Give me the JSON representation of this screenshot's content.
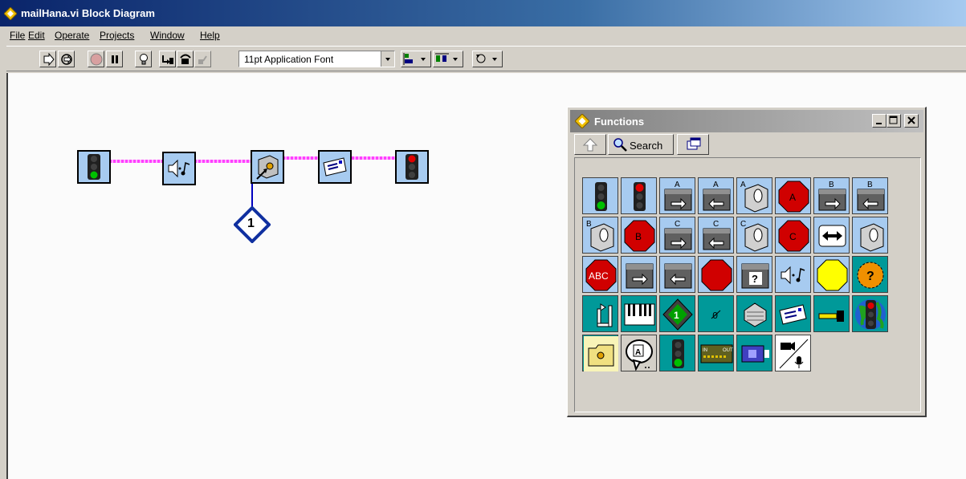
{
  "window": {
    "title": "mailHana.vi Block Diagram"
  },
  "menu": [
    "File",
    "Edit",
    "Operate",
    "Projects",
    "Window",
    "Help"
  ],
  "toolbar": {
    "font": "11pt Application Font",
    "buttons": [
      "run",
      "run-continuously",
      "abort",
      "pause",
      "highlight-execution",
      "step-into",
      "step-over",
      "step-out",
      "align",
      "distribute",
      "reorder"
    ]
  },
  "diagram": {
    "nodes": [
      "traffic-light-green",
      "speaker-note",
      "rcx-motor",
      "mail",
      "traffic-light-red"
    ],
    "constant_value": "1"
  },
  "palette": {
    "title": "Functions",
    "search_label": "Search",
    "icons": [
      [
        "traffic-light-green",
        "traffic-light-red",
        "motor-a-fwd",
        "motor-a-rev",
        "motor-a-sensor",
        "stop-a",
        "motor-b-fwd",
        "motor-b-rev"
      ],
      [
        "motor-b-sensor",
        "stop-b",
        "motor-c-fwd",
        "motor-c-rev",
        "motor-c-sensor",
        "stop-c",
        "two-way-arrow",
        "sensor"
      ],
      [
        "stop-abc",
        "rcx-brick",
        "rcx-brick-left",
        "stop-red",
        "rcx-question",
        "speaker-note",
        "yellow-octagon",
        "timer-question"
      ],
      [
        "loop-return",
        "piano",
        "rcx-nav",
        "zero-constant",
        "cake",
        "mail",
        "plug",
        "traffic-earth"
      ],
      [
        "folder",
        "speech-bubble",
        "traffic-light-teal",
        "io-board",
        "rcx-board",
        "camera-mic"
      ]
    ]
  },
  "colors": {
    "title_active": "#0a246a",
    "wire": "#ff40ff",
    "node_blue": "#a7cbf0",
    "teal": "#009999"
  }
}
